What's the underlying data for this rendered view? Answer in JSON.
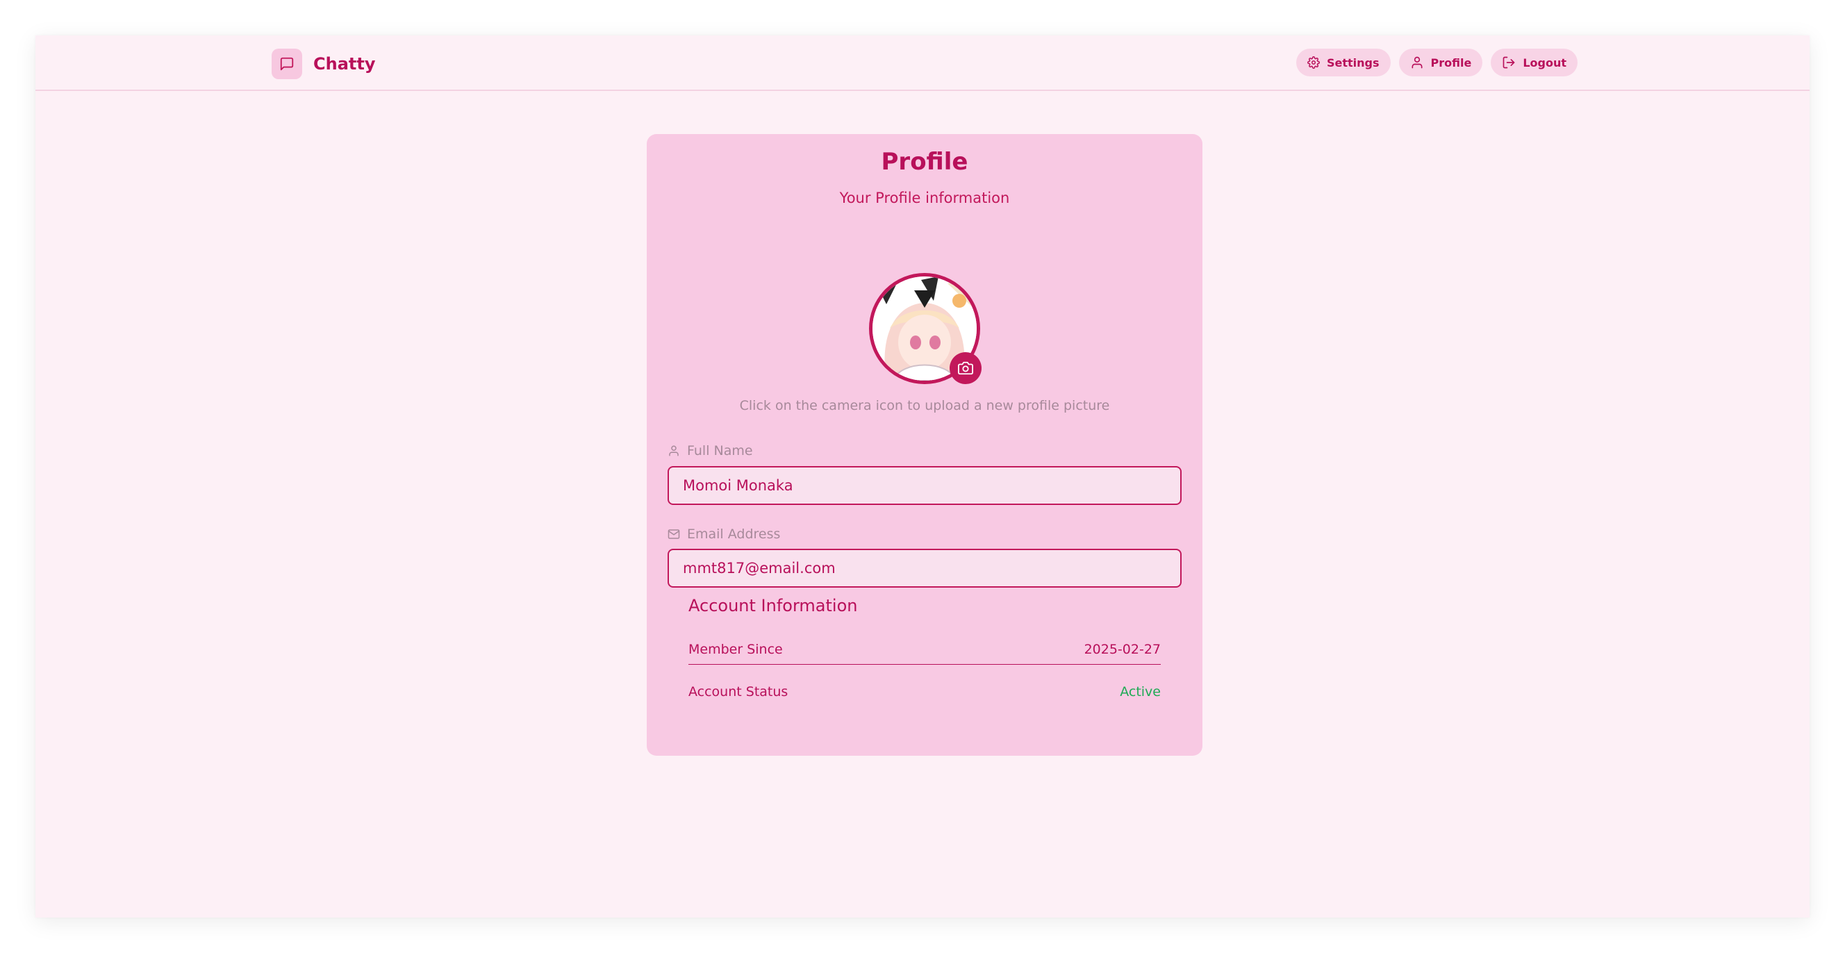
{
  "window": {
    "app_name": "Chatty"
  },
  "nav": {
    "settings_label": "Settings",
    "profile_label": "Profile",
    "logout_label": "Logout"
  },
  "card": {
    "title": "Profile",
    "subtitle": "Your Profile information",
    "avatar_hint": "Click on the camera icon to upload a new profile picture",
    "full_name": {
      "label": "Full Name",
      "value": "Momoi Monaka"
    },
    "email": {
      "label": "Email Address",
      "value": "mmt817@email.com"
    },
    "account": {
      "title": "Account Information",
      "member_since_label": "Member Since",
      "member_since_value": "2025-02-27",
      "status_label": "Account Status",
      "status_value": "Active"
    }
  },
  "colors": {
    "accent": "#c2185b",
    "background": "#fdf0f6",
    "card": "#f8c9e3",
    "status_active": "#1faa55"
  },
  "icons": {
    "brand": "message-square-icon",
    "settings": "gear-icon",
    "profile": "user-icon",
    "logout": "logout-icon",
    "camera": "camera-icon",
    "name_field": "user-icon",
    "email_field": "mail-icon"
  }
}
